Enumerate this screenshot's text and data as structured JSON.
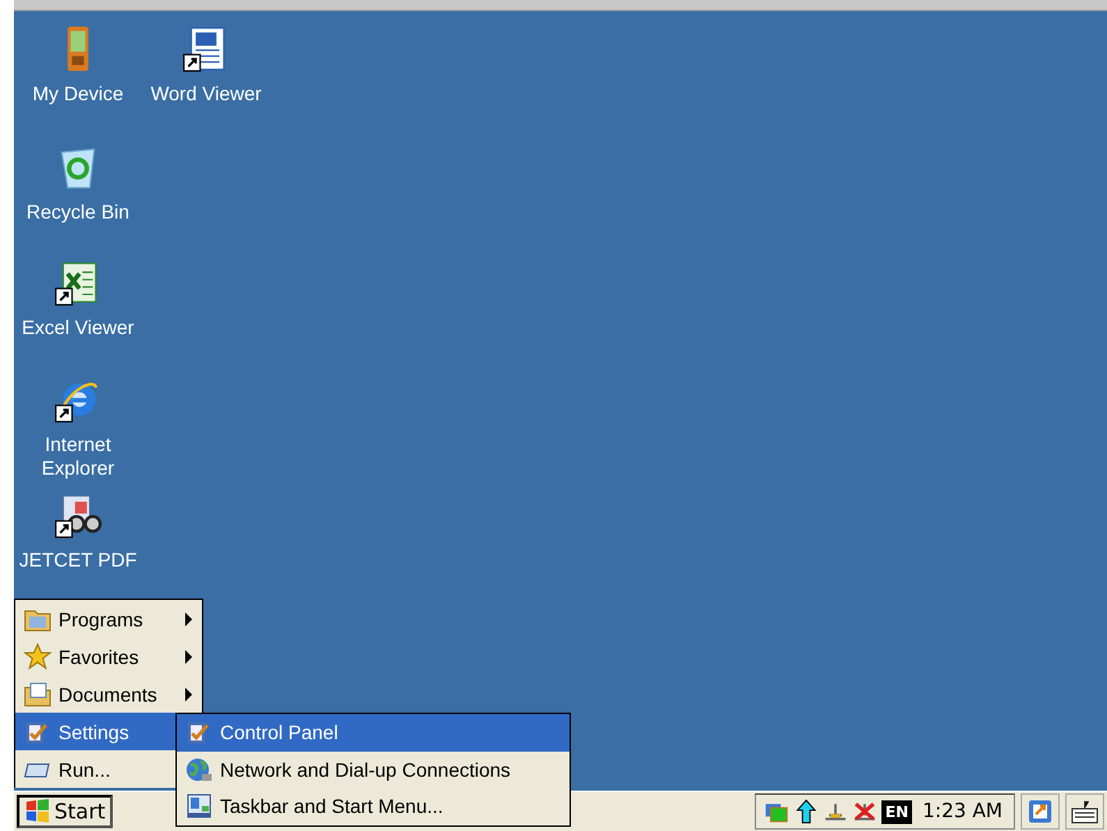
{
  "desktop_icons": [
    {
      "label": "My Device",
      "kind": "device",
      "shortcut": false
    },
    {
      "label": "Word Viewer",
      "kind": "word",
      "shortcut": true
    },
    {
      "label": "Recycle Bin",
      "kind": "recycle",
      "shortcut": false
    },
    {
      "label": "Excel Viewer",
      "kind": "excel",
      "shortcut": true
    },
    {
      "label": "Internet Explorer",
      "kind": "ie",
      "shortcut": true
    },
    {
      "label": "JETCET PDF",
      "kind": "pdf",
      "shortcut": true
    }
  ],
  "start_menu": {
    "items": [
      {
        "label": "Programs",
        "kind": "programs",
        "submenu": true,
        "selected": false
      },
      {
        "label": "Favorites",
        "kind": "favorites",
        "submenu": true,
        "selected": false
      },
      {
        "label": "Documents",
        "kind": "documents",
        "submenu": true,
        "selected": false
      },
      {
        "label": "Settings",
        "kind": "settings",
        "submenu": true,
        "selected": true
      },
      {
        "label": "Run...",
        "kind": "run",
        "submenu": false,
        "selected": false
      }
    ]
  },
  "settings_submenu": {
    "items": [
      {
        "label": "Control Panel",
        "kind": "control",
        "selected": true
      },
      {
        "label": "Network and Dial-up Connections",
        "kind": "network",
        "selected": false
      },
      {
        "label": "Taskbar and Start Menu...",
        "kind": "taskbar",
        "selected": false
      }
    ]
  },
  "taskbar": {
    "start_button": "Start",
    "language": "EN",
    "clock": "1:23 AM"
  }
}
